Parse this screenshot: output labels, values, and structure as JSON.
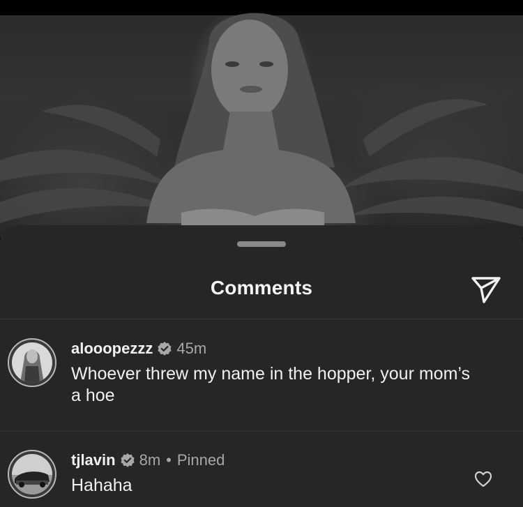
{
  "sheet": {
    "title": "Comments"
  },
  "comments": [
    {
      "username": "alooopezzz",
      "verified": true,
      "time": "45m",
      "text": "Whoever threw my name in the hopper, your mom’s a hoe",
      "pinned": ""
    },
    {
      "username": "tjlavin",
      "verified": true,
      "time": "8m",
      "separator": "•",
      "pinned": "Pinned",
      "text": "Hahaha"
    }
  ],
  "icons": {
    "share": "paper-plane-icon",
    "verified": "verified-badge-icon",
    "like": "heart-outline-icon"
  },
  "colors": {
    "sheet_background": "#262626",
    "primary_text": "#f2f2f2",
    "secondary_text": "#a8a8a8"
  }
}
